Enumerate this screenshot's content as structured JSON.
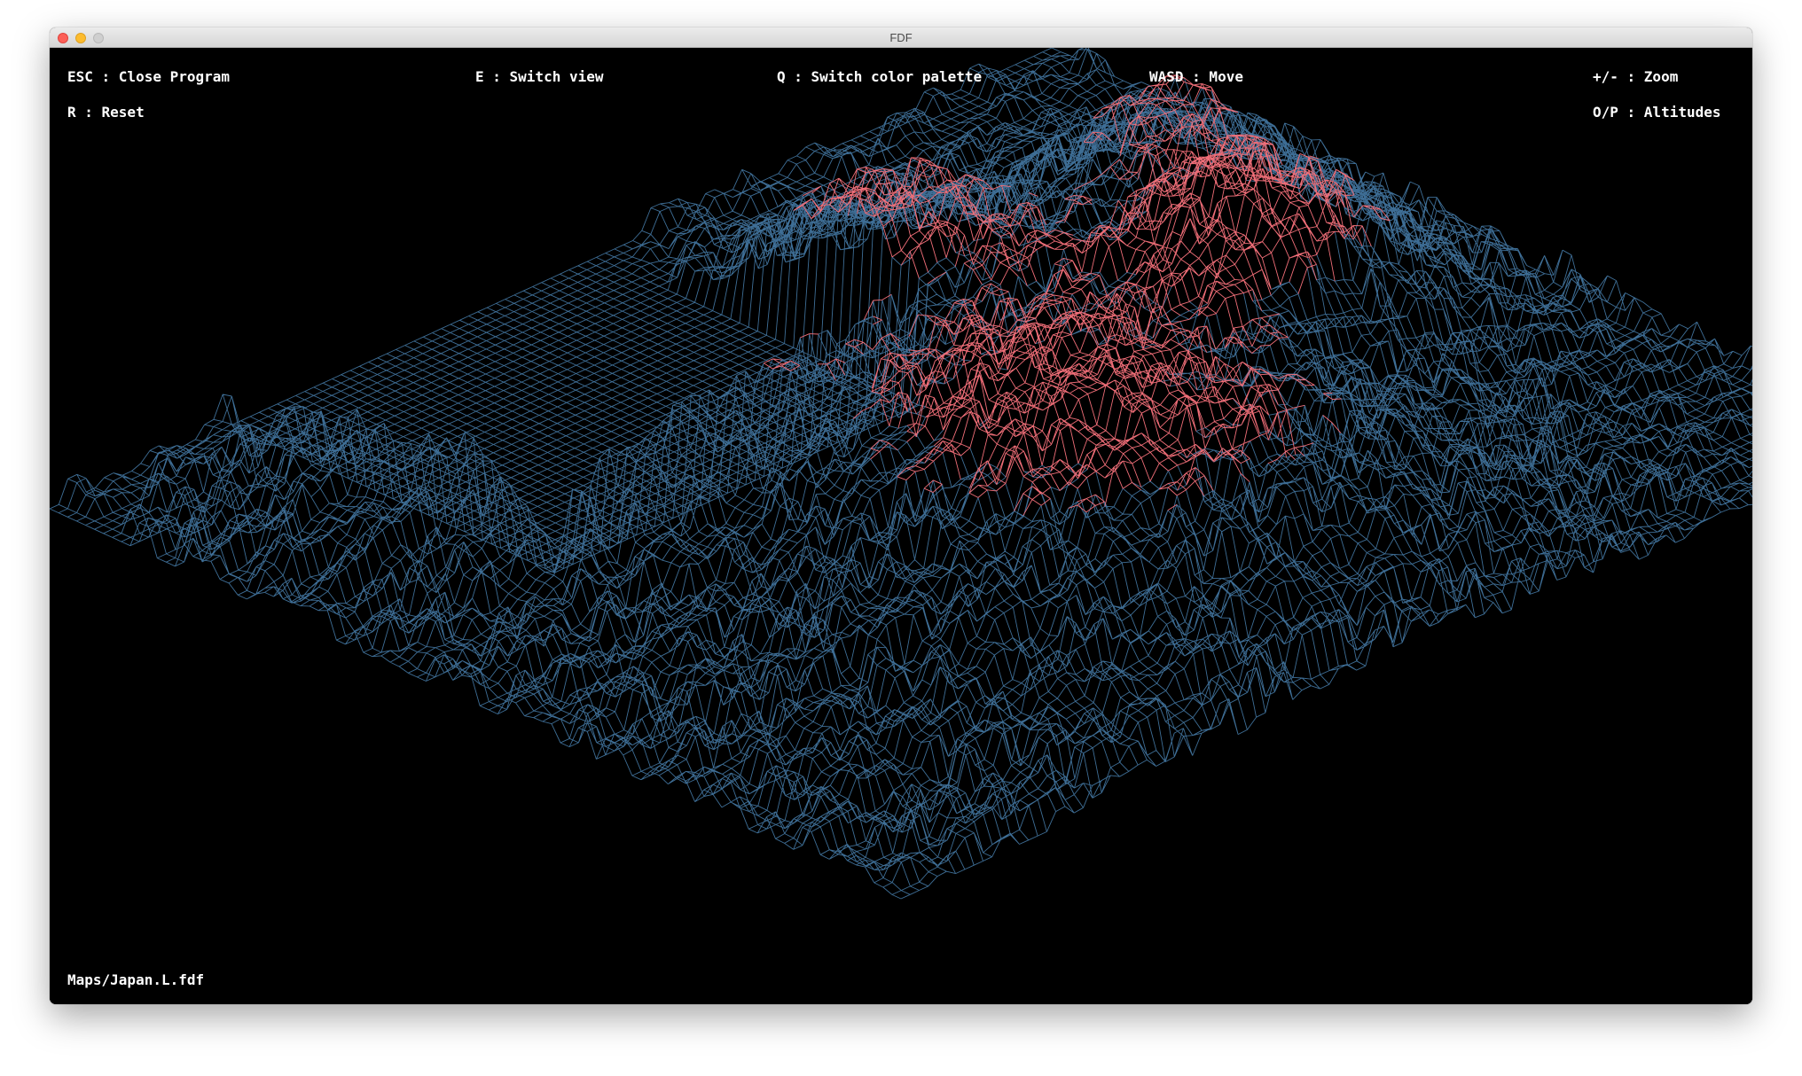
{
  "window": {
    "title": "FDF"
  },
  "controls": {
    "close_program": "ESC : Close Program",
    "switch_view": "E : Switch view",
    "switch_palette": "Q : Switch color palette",
    "move": "WASD : Move",
    "zoom": "+/- : Zoom",
    "reset": "R : Reset",
    "altitudes": "O/P : Altitudes"
  },
  "map_file": "Maps/Japan.L.fdf",
  "palette": {
    "low": "#3e6e96",
    "high": "#f06e78",
    "background": "#000000",
    "text": "#ffffff"
  },
  "icons": {
    "close": "close-button-icon",
    "minimize": "minimize-button-icon",
    "zoom": "zoom-button-icon"
  }
}
